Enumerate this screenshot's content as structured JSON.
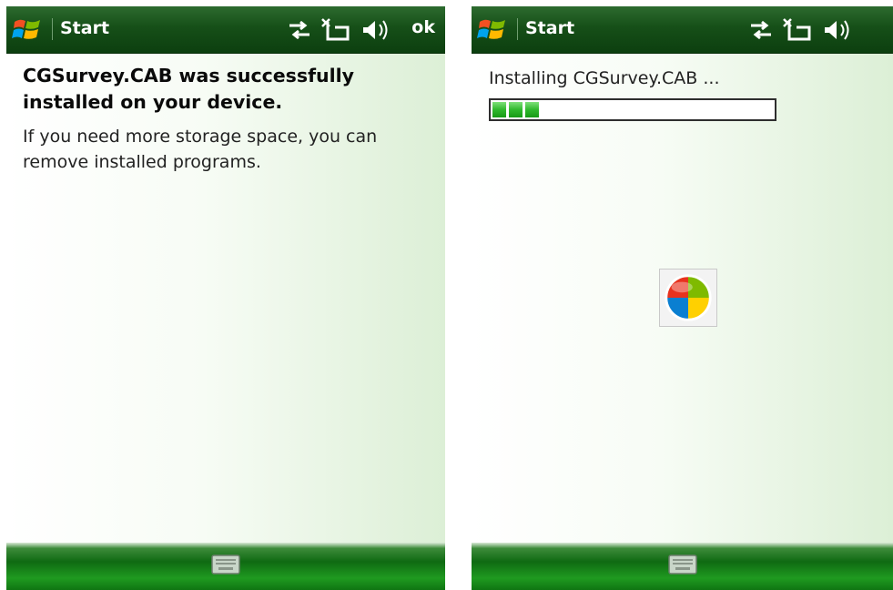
{
  "left": {
    "titlebar": {
      "title": "Start",
      "ok_label": "ok",
      "icons": [
        "windows-logo-icon",
        "connectivity-icon",
        "signal-off-icon",
        "volume-icon"
      ]
    },
    "message": {
      "title": "CGSurvey.CAB was successfully installed on your device.",
      "body": "If you need more storage space, you can remove installed programs."
    },
    "bottombar": {
      "icon": "keyboard-icon"
    }
  },
  "right": {
    "titlebar": {
      "title": "Start",
      "icons": [
        "windows-logo-icon",
        "connectivity-icon",
        "signal-off-icon",
        "volume-icon"
      ]
    },
    "install": {
      "status_text": "Installing CGSurvey.CAB ...",
      "progress_fraction": 0.17
    },
    "busy_icon": "windows-busy-icon",
    "bottombar": {
      "icon": "keyboard-icon"
    }
  },
  "colors": {
    "titlebar_green": "#164f18",
    "progress_green": "#2fb82c",
    "bottombar_green": "#1f9a20"
  }
}
